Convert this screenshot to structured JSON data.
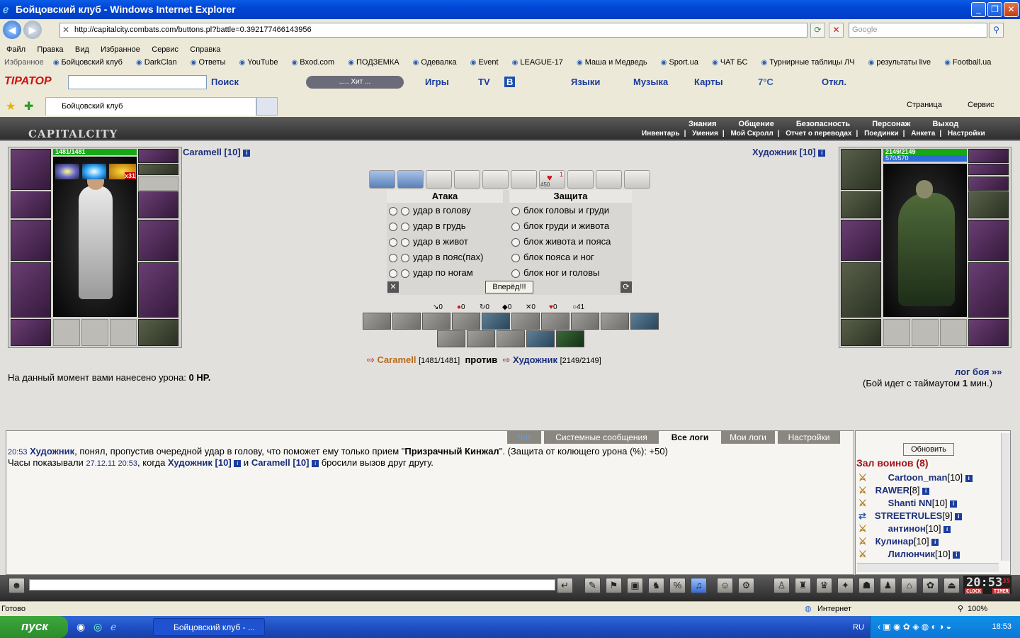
{
  "window": {
    "title": "Бойцовский клуб - Windows Internet Explorer"
  },
  "address": {
    "url": "http://capitalcity.combats.com/buttons.pl?battle=0.392177466143956",
    "search_placeholder": "Google"
  },
  "menu": [
    "Файл",
    "Правка",
    "Вид",
    "Избранное",
    "Сервис",
    "Справка"
  ],
  "favorites": {
    "label": "Избранное",
    "items": [
      "Бойцовский клуб",
      "DarkClan",
      "Ответы",
      "YouTube",
      "Bxod.com",
      "ПОДЗЕМКА",
      "Одевалка",
      "Event",
      "LEAGUE-17",
      "Маша и Медведь",
      "Sport.ua",
      "ЧАТ БС",
      "Турнирные таблицы ЛЧ",
      "результаты live",
      "Football.ua"
    ]
  },
  "toolbar2": {
    "brand": "TIPATOP",
    "search": "Поиск",
    "player": "..... Хит ...",
    "games": "Игры",
    "tv": "TV",
    "b": "B",
    "langs": "Языки",
    "music": "Музыка",
    "maps": "Карты",
    "weather": "7°C",
    "off": "Откл."
  },
  "tabbar": {
    "tab": "Бойцовский клуб",
    "page": "Страница",
    "service": "Сервис"
  },
  "game": {
    "logo": "CAPITALCITY",
    "top_menu": [
      "Знания",
      "Общение",
      "Безопасность",
      "Персонаж",
      "Выход"
    ],
    "sub_menu": [
      "Инвентарь",
      "Умения",
      "Мой Скролл",
      "Отчет о переводах",
      "Поединки",
      "Анкета",
      "Настройки"
    ],
    "player": {
      "name": "Caramell",
      "level": "[10]",
      "hp": "1481/1481",
      "hp_fraction": 1.0,
      "buff_count": "x31"
    },
    "enemy": {
      "name": "Художник",
      "level": "[10]",
      "hp": "2149/2149",
      "mp": "570/570",
      "hp_fraction": 1.0,
      "mp_fraction": 1.0
    },
    "scroll_badge": "1",
    "scroll_value": "450",
    "attack_header": "Атака",
    "defense_header": "Защита",
    "attacks": [
      "удар в голову",
      "удар в грудь",
      "удар в живот",
      "удар в пояс(пах)",
      "удар по ногам"
    ],
    "defenses": [
      "блок головы и груди",
      "блок груди и живота",
      "блок живота и пояса",
      "блок пояса и ног",
      "блок ног и головы"
    ],
    "go_button": "Вперёд!!!",
    "stats": [
      "0",
      "0",
      "0",
      "0",
      "0",
      "0",
      "41"
    ],
    "vs_line": {
      "p1": "Caramell",
      "p1hp": "[1481/1481]",
      "vs": "против",
      "p2": "Художник",
      "p2hp": "[2149/2149]"
    },
    "damage_text": "На данный момент вами нанесено урона:",
    "damage_value": "0 HP.",
    "log_link": "лог боя »»",
    "timeout_text": "(Бой идет с таймаутом",
    "timeout_value": "1",
    "timeout_unit": "мин.)"
  },
  "chat": {
    "tabs": [
      "Чат",
      "Системные сообщения",
      "Все логи",
      "Мои логи",
      "Настройки"
    ],
    "line1": {
      "time": "20:53",
      "name": "Художник",
      "text": ", понял, пропустив очередной удар в голову, что поможет ему только прием \"",
      "skill": "Призрачный Кинжал",
      "rest": "\". (Защита от колющего урона (%): +50)"
    },
    "line2": {
      "pre": "Часы показывали",
      "date": "27.12.11 20:53",
      "mid": ", когда",
      "p1": "Художник [10]",
      "and": "и",
      "p2": "Caramell [10]",
      "post": "бросили вызов друг другу."
    }
  },
  "hall": {
    "refresh": "Обновить",
    "title": "Зал воинов (8)",
    "players": [
      {
        "name": "Cartoon_man",
        "lv": "[10]"
      },
      {
        "name": "RAWER",
        "lv": "[8]"
      },
      {
        "name": "Shanti NN",
        "lv": "[10]"
      },
      {
        "name": "STREETRULES",
        "lv": "[9]"
      },
      {
        "name": "антинон",
        "lv": "[10]"
      },
      {
        "name": "Кулинар",
        "lv": "[10]"
      },
      {
        "name": "Лилюнчик",
        "lv": "[10]"
      }
    ]
  },
  "clock": {
    "time": "20:53",
    "sec": "35",
    "label1": "CLOCK",
    "label2": "TIMER"
  },
  "status": {
    "text": "Готово",
    "zone": "Интернет",
    "zoom": "100%"
  },
  "taskbar": {
    "start": "пуск",
    "item": "Бойцовский клуб - ...",
    "lang": "RU",
    "time": "18:53"
  }
}
